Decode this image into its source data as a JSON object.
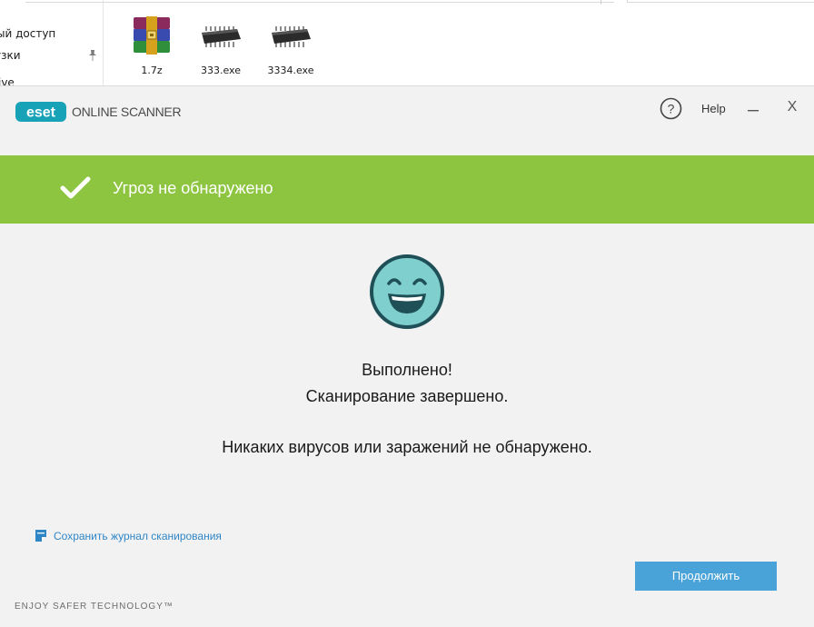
{
  "explorer": {
    "nav_items": [
      "ый доступ",
      "узки",
      "ive"
    ],
    "files": [
      {
        "name": "1.7z",
        "icon": "winrar-archive-icon"
      },
      {
        "name": "333.exe",
        "icon": "chip-executable-icon"
      },
      {
        "name": "3334.exe",
        "icon": "chip-executable-icon"
      }
    ]
  },
  "eset": {
    "logo_text": "eset",
    "brand": "ONLINE SCANNER",
    "help_label": "Help",
    "close_glyph": "X",
    "banner_text": "Угроз не обнаружено",
    "message_line1": "Выполнено!",
    "message_line2": "Сканирование завершено.",
    "message_line3": "Никаких вирусов или заражений не обнаружено.",
    "save_log_label": "Сохранить журнал сканирования",
    "continue_label": "Продолжить",
    "footer": "ENJOY SAFER TECHNOLOGY™",
    "colors": {
      "brand_teal": "#17a2b8",
      "banner_green": "#8dc540",
      "button_blue": "#4aa3d8",
      "link_blue": "#2f86c7",
      "smiley_fill": "#7fcfcf"
    }
  }
}
